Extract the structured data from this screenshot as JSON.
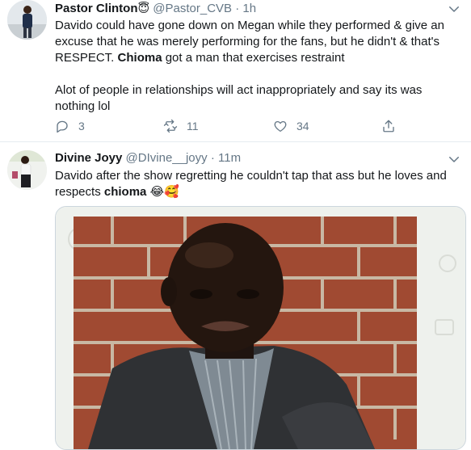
{
  "tweets": [
    {
      "name": "Pastor Clinton",
      "name_emoji": "😇",
      "handle": "@Pastor_CVB",
      "separator": "·",
      "time": "1h",
      "body": {
        "p1_a": "Davido could have gone down on Megan while they performed & give an excuse that he was merely performing for the fans, but he didn't & that's RESPECT.",
        "p1_bold": "Chioma",
        "p1_b": "got a man that exercises restraint",
        "p2": "Alot of people in relationships will act inappropriately and say its was nothing lol"
      },
      "actions": {
        "reply_count": "3",
        "retweet_count": "11",
        "like_count": "34"
      }
    },
    {
      "name": "Divine Joyy",
      "handle": "@DIvine__joyy",
      "separator": "·",
      "time": "11m",
      "body": {
        "text_a": "Davido after the show regretting he couldn't tap that ass but he loves and respects",
        "text_bold": "chioma",
        "emojis": "😂🥰"
      }
    }
  ],
  "colors": {
    "text": "#14171a",
    "muted": "#657786",
    "divider": "#e6ecf0"
  },
  "icons": [
    "reply-icon",
    "retweet-icon",
    "like-icon",
    "share-icon",
    "chevron-down-icon"
  ]
}
